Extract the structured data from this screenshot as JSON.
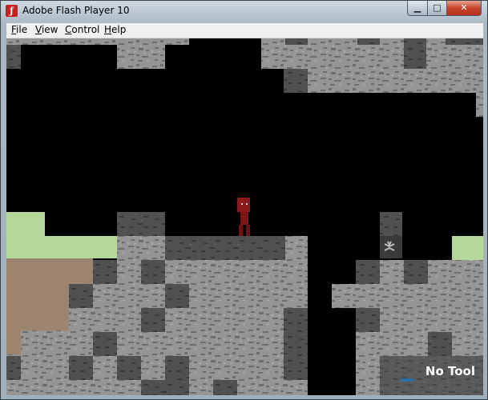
{
  "window": {
    "title": "Adobe Flash Player 10",
    "icon": "flash-icon"
  },
  "controls": {
    "minimize": "minimize-icon",
    "maximize": "maximize-icon",
    "close": "close-icon"
  },
  "menu": [
    "File",
    "View",
    "Control",
    "Help"
  ],
  "game": {
    "hud": {
      "tool_label": "No Tool"
    },
    "player": {
      "color": "#8b1a1a"
    },
    "colors": {
      "stone": "#8f8f8f",
      "stone_dark": "#4a4a4a",
      "grass": "#b3d89a",
      "dirt": "#9c846f",
      "sky": "#000000"
    }
  }
}
